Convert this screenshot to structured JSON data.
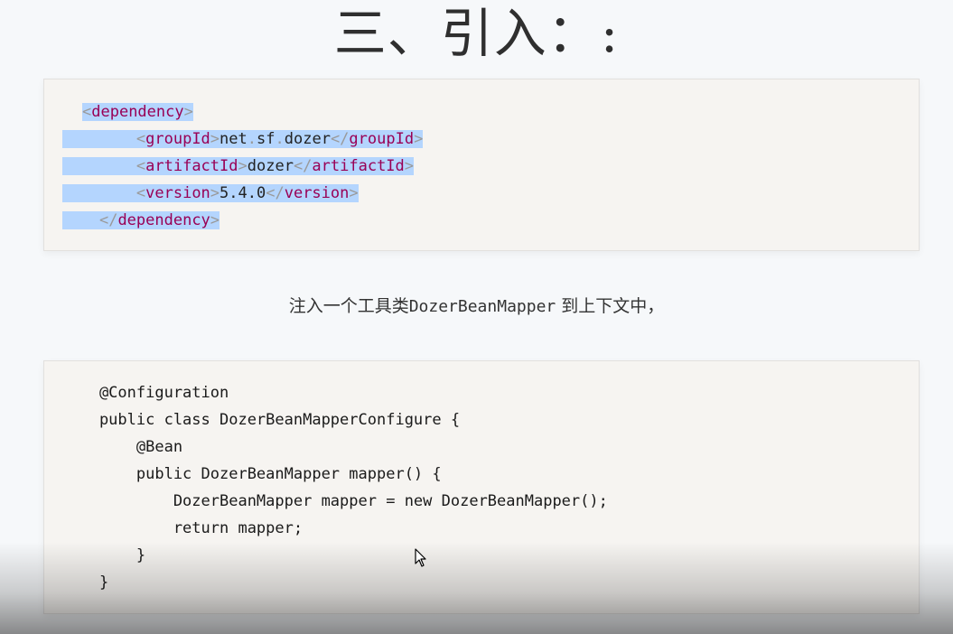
{
  "heading": "三、引入：:",
  "xml_code": {
    "lines": [
      {
        "indent": "  ",
        "open": "dependency"
      },
      {
        "indent": "      ",
        "tag": "groupId",
        "value_parts": [
          "net",
          ".",
          "sf",
          ".",
          "dozer"
        ]
      },
      {
        "indent": "      ",
        "tag": "artifactId",
        "value": "dozer"
      },
      {
        "indent": "      ",
        "tag": "version",
        "value": "5.4.0"
      },
      {
        "indent": "    ",
        "close": "dependency"
      }
    ]
  },
  "caption": {
    "prefix": "注入一个工具类",
    "mono": "DozerBeanMapper",
    "suffix": " 到上下文中，"
  },
  "java_code": {
    "lines": [
      "    @Configuration",
      "    public class DozerBeanMapperConfigure {",
      "        @Bean",
      "        public DozerBeanMapper mapper() {",
      "            DozerBeanMapper mapper = new DozerBeanMapper();",
      "            return mapper;",
      "        }",
      "    }"
    ]
  },
  "icons": {
    "cursor": "mouse-pointer-icon"
  }
}
